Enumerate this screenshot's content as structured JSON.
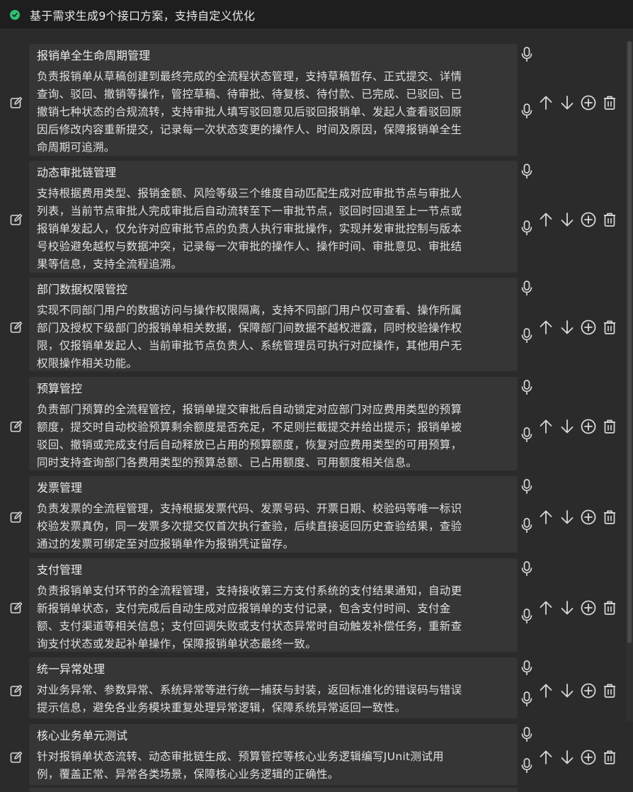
{
  "header": {
    "status_icon": "check-circle-icon",
    "text": "基于需求生成9个接口方案，支持自定义优化",
    "accent_color": "#2fbf71"
  },
  "items": [
    {
      "title": "报销单全生命周期管理",
      "lines": [
        "负责报销单从草稿创建到最终完成的全流程状态管理，支持草稿暂存、正式提交、详情",
        "查询、驳回、撤销等操作，管控草稿、待审批、待复核、待付款、已完成、已驳回、已",
        "撤销七种状态的合规流转，支持审批人填写驳回意见后驳回报销单、发起人查看驳回原",
        "因后修改内容重新提交，记录每一次状态变更的操作人、时间及原因，保障报销单全生",
        "命周期可追溯。"
      ]
    },
    {
      "title": "动态审批链管理",
      "lines": [
        "支持根据费用类型、报销金额、风险等级三个维度自动匹配生成对应审批节点与审批人",
        "列表，当前节点审批人完成审批后自动流转至下一审批节点，驳回时回退至上一节点或",
        "报销单发起人，仅允许对应审批节点的负责人执行审批操作，实现并发审批控制与版本",
        "号校验避免越权与数据冲突，记录每一次审批的操作人、操作时间、审批意见、审批结",
        "果等信息，支持全流程追溯。"
      ]
    },
    {
      "title": "部门数据权限管控",
      "lines": [
        "实现不同部门用户的数据访问与操作权限隔离，支持不同部门用户仅可查看、操作所属",
        "部门及授权下级部门的报销单相关数据，保障部门间数据不越权泄露，同时校验操作权",
        "限，仅报销单发起人、当前审批节点负责人、系统管理员可执行对应操作，其他用户无",
        "权限操作相关功能。"
      ]
    },
    {
      "title": "预算管控",
      "lines": [
        "负责部门预算的全流程管控，报销单提交审批后自动锁定对应部门对应费用类型的预算",
        "额度，提交时自动校验预算剩余额度是否充足，不足则拦截提交并给出提示；报销单被",
        "驳回、撤销或完成支付后自动释放已占用的预算额度，恢复对应费用类型的可用预算，",
        "同时支持查询部门各费用类型的预算总额、已占用额度、可用额度相关信息。"
      ]
    },
    {
      "title": "发票管理",
      "lines": [
        "负责发票的全流程管理，支持根据发票代码、发票号码、开票日期、校验码等唯一标识",
        "校验发票真伪，同一发票多次提交仅首次执行查验，后续直接返回历史查验结果，查验",
        "通过的发票可绑定至对应报销单作为报销凭证留存。"
      ]
    },
    {
      "title": "支付管理",
      "lines": [
        "负责报销单支付环节的全流程管理，支持接收第三方支付系统的支付结果通知，自动更",
        "新报销单状态，支付完成后自动生成对应报销单的支付记录，包含支付时间、支付金",
        "额、支付渠道等相关信息；支付回调失败或支付状态异常时自动触发补偿任务，重新查",
        "询支付状态或发起补单操作，保障报销单状态最终一致。"
      ]
    },
    {
      "title": "统一异常处理",
      "lines": [
        "对业务异常、参数异常、系统异常等进行统一捕获与封装，返回标准化的错误码与错误",
        "提示信息，避免各业务模块重复处理异常逻辑，保障系统异常返回一致性。"
      ]
    },
    {
      "title": "核心业务单元测试",
      "lines": [
        "针对报销单状态流转、动态审批链生成、预算管控等核心业务逻辑编写JUnit测试用",
        "例，覆盖正常、异常各类场景，保障核心业务逻辑的正确性。"
      ]
    }
  ],
  "icons": {
    "edit": "edit-icon",
    "mic": "microphone-icon",
    "up": "arrow-up-icon",
    "down": "arrow-down-icon",
    "add": "plus-circle-icon",
    "delete": "trash-icon"
  }
}
